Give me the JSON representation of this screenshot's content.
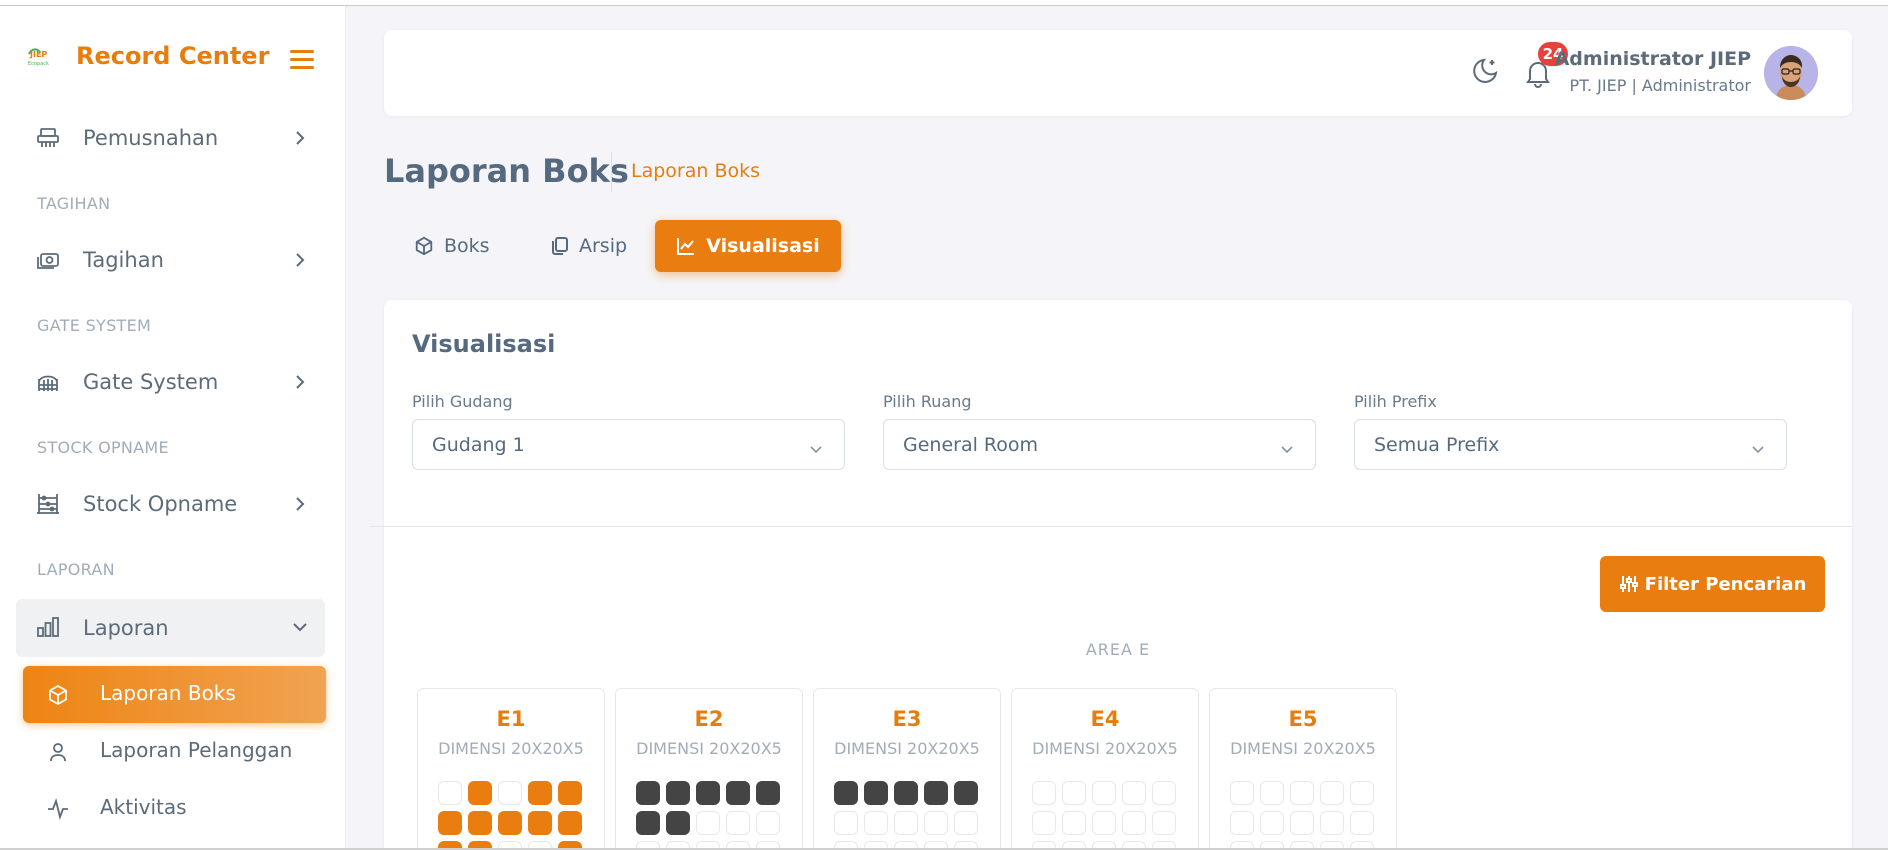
{
  "sidebar": {
    "brand": "Record Center",
    "brand_logo_text": "JIEP Ecopack",
    "items": [
      {
        "label": "Pemusnahan"
      },
      {
        "header": "TAGIHAN",
        "label": "Tagihan"
      },
      {
        "header": "GATE SYSTEM",
        "label": "Gate System"
      },
      {
        "header": "STOCK OPNAME",
        "label": "Stock Opname"
      },
      {
        "header": "LAPORAN",
        "label": "Laporan"
      }
    ],
    "sub_items": [
      {
        "label": "Laporan Boks",
        "active": true
      },
      {
        "label": "Laporan Pelanggan"
      },
      {
        "label": "Aktivitas"
      }
    ]
  },
  "navbar": {
    "notification_count": "24",
    "user_name": "Administrator JIEP",
    "user_role": "PT. JIEP | Administrator"
  },
  "page": {
    "title": "Laporan Boks",
    "breadcrumb": "Laporan Boks"
  },
  "tabs": [
    {
      "label": "Boks"
    },
    {
      "label": "Arsip"
    },
    {
      "label": "Visualisasi",
      "active": true
    }
  ],
  "card": {
    "title": "Visualisasi",
    "filters": [
      {
        "label": "Pilih Gudang",
        "value": "Gudang 1"
      },
      {
        "label": "Pilih Ruang",
        "value": "General Room"
      },
      {
        "label": "Pilih Prefix",
        "value": "Semua Prefix"
      }
    ],
    "filter_button": "Filter Pencarian",
    "area_label": "AREA E",
    "shelves": [
      {
        "name": "E1",
        "dim": "DIMENSI 20X20X5",
        "cells": [
          "e",
          "f",
          "e",
          "f",
          "f",
          "f",
          "f",
          "f",
          "f",
          "f",
          "f",
          "f",
          "e",
          "e",
          "f"
        ]
      },
      {
        "name": "E2",
        "dim": "DIMENSI 20X20X5",
        "cells": [
          "d",
          "d",
          "d",
          "d",
          "d",
          "d",
          "d",
          "e",
          "e",
          "e",
          "e",
          "e",
          "e",
          "e",
          "e"
        ]
      },
      {
        "name": "E3",
        "dim": "DIMENSI 20X20X5",
        "cells": [
          "d",
          "d",
          "d",
          "d",
          "d",
          "e",
          "e",
          "e",
          "e",
          "e",
          "e",
          "e",
          "e",
          "e",
          "e"
        ]
      },
      {
        "name": "E4",
        "dim": "DIMENSI 20X20X5",
        "cells": [
          "e",
          "e",
          "e",
          "e",
          "e",
          "e",
          "e",
          "e",
          "e",
          "e",
          "e",
          "e",
          "e",
          "e",
          "e"
        ]
      },
      {
        "name": "E5",
        "dim": "DIMENSI 20X20X5",
        "cells": [
          "e",
          "e",
          "e",
          "e",
          "e",
          "e",
          "e",
          "e",
          "e",
          "e",
          "e",
          "e",
          "e",
          "e",
          "e"
        ]
      }
    ]
  },
  "colors": {
    "accent": "#ea7d0f",
    "filled_dark": "#444444",
    "badge": "#e8413c"
  }
}
